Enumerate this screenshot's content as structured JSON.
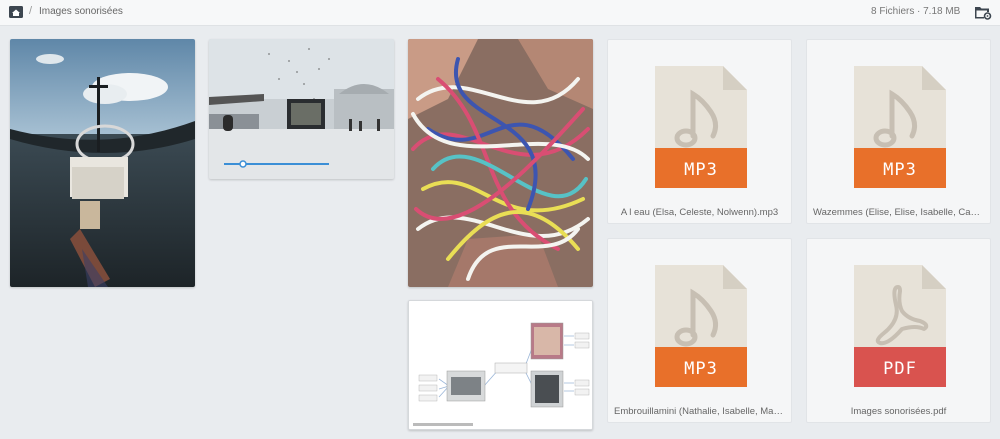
{
  "header": {
    "breadcrumb_separator": "/",
    "folder_name": "Images sonorisées",
    "file_count": "8 Fichiers",
    "total_size": "· 7.18 MB"
  },
  "files": [
    {
      "type": "image",
      "icon": "boat-photo"
    },
    {
      "type": "image",
      "icon": "street-photo"
    },
    {
      "type": "image",
      "icon": "yarn-photo"
    },
    {
      "type": "audio",
      "badge": "MP3",
      "name": "A l eau (Elsa, Celeste, Nolwenn).mp3"
    },
    {
      "type": "audio",
      "badge": "MP3",
      "name": "Wazemmes (Elise, Elise, Isabelle, Cameli..."
    },
    {
      "type": "image",
      "icon": "mindmap-photo"
    },
    {
      "type": "audio",
      "badge": "MP3",
      "name": "Embrouillamini (Nathalie, Isabelle, Mari..."
    },
    {
      "type": "pdf",
      "badge": "PDF",
      "name": "Images sonorisées.pdf"
    }
  ],
  "colors": {
    "mp3_badge": "#e8702a",
    "pdf_badge": "#d9534f",
    "doc_body": "#e7e2d8",
    "doc_icon": "#c7bfb3"
  }
}
